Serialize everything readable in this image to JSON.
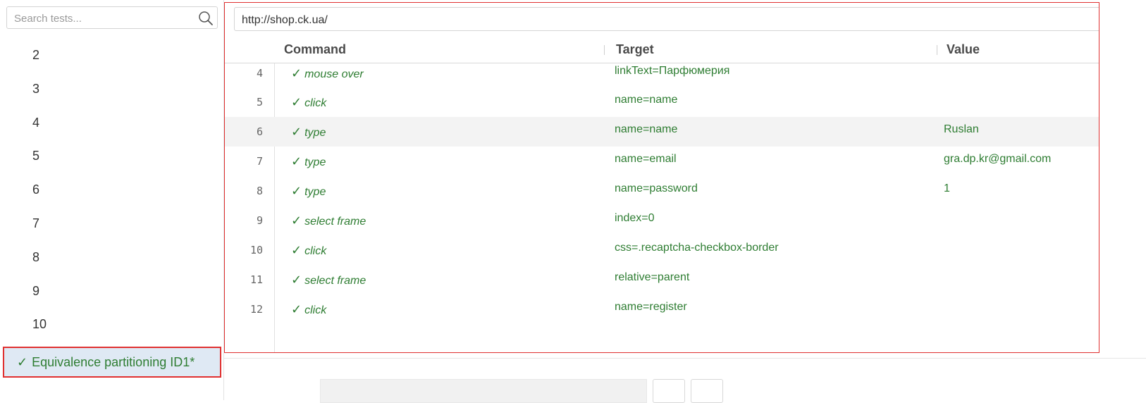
{
  "sidebar": {
    "search_placeholder": "Search tests...",
    "tests": [
      "2",
      "3",
      "4",
      "5",
      "6",
      "7",
      "8",
      "9",
      "10"
    ],
    "selected_test": {
      "check": "✓",
      "label": "Equivalence partitioning ID1*"
    }
  },
  "main": {
    "base_url": "http://shop.ck.ua/",
    "headers": {
      "command": "Command",
      "target": "Target",
      "value": "Value"
    },
    "rows": [
      {
        "num": "4",
        "command": "mouse over",
        "target": "linkText=Парфюмерия",
        "value": ""
      },
      {
        "num": "5",
        "command": "click",
        "target": "name=name",
        "value": ""
      },
      {
        "num": "6",
        "command": "type",
        "target": "name=name",
        "value": "Ruslan"
      },
      {
        "num": "7",
        "command": "type",
        "target": "name=email",
        "value": "gra.dp.kr@gmail.com"
      },
      {
        "num": "8",
        "command": "type",
        "target": "name=password",
        "value": "1"
      },
      {
        "num": "9",
        "command": "select frame",
        "target": "index=0",
        "value": ""
      },
      {
        "num": "10",
        "command": "click",
        "target": "css=.recaptcha-checkbox-border",
        "value": ""
      },
      {
        "num": "11",
        "command": "select frame",
        "target": "relative=parent",
        "value": ""
      },
      {
        "num": "12",
        "command": "click",
        "target": "name=register",
        "value": ""
      }
    ],
    "check_glyph": "✓"
  },
  "colors": {
    "success_text": "#2e7d32",
    "highlight_border": "#e03030",
    "selected_bg": "#dfe9f4",
    "highlight_row_bg": "#f3f3f3"
  },
  "icons": {
    "search": "search-icon"
  }
}
